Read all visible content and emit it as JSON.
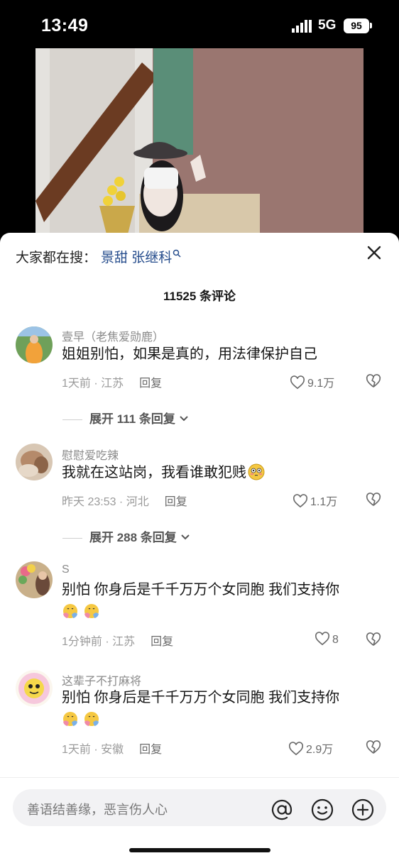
{
  "status_bar": {
    "time": "13:49",
    "network": "5G",
    "battery": "95"
  },
  "search": {
    "prefix": "大家都在搜：",
    "keyword": "景甜 张继科"
  },
  "comments_count": "11525 条评论",
  "comments": [
    {
      "author": "壹早（老焦爱勋鹿）",
      "text": "姐姐别怕，如果是真的，用法律保护自己",
      "meta": "1天前 · 江苏",
      "reply_label": "回复",
      "likes": "9.1万",
      "expand": "展开 111 条回复"
    },
    {
      "author": "慰慰爱吃辣",
      "text": "我就在这站岗，我看谁敢犯贱",
      "meta": "昨天 23:53 · 河北",
      "reply_label": "回复",
      "likes": "1.1万",
      "expand": "展开 288 条回复"
    },
    {
      "author": "S",
      "text": "别怕 你身后是千千万万个女同胞 我们支持你",
      "meta": "1分钟前 · 江苏",
      "reply_label": "回复",
      "likes": "8"
    },
    {
      "author": "这辈子不打麻将",
      "text": "别怕 你身后是千千万万个女同胞 我们支持你",
      "meta": "1天前 · 安徽",
      "reply_label": "回复",
      "likes": "2.9万"
    }
  ],
  "input": {
    "placeholder": "善语结善缘，恶言伤人心"
  },
  "icons": {
    "close": "close-icon",
    "heart": "heart-icon",
    "dislike": "broken-heart-icon",
    "at": "at-icon",
    "emoji": "emoji-icon",
    "plus": "plus-icon",
    "chevron": "chevron-down-icon",
    "search": "search-icon"
  },
  "colors": {
    "keyword": "#254c8c",
    "sheet_bg": "#ffffff",
    "secondary_text": "#8a8a8a"
  }
}
